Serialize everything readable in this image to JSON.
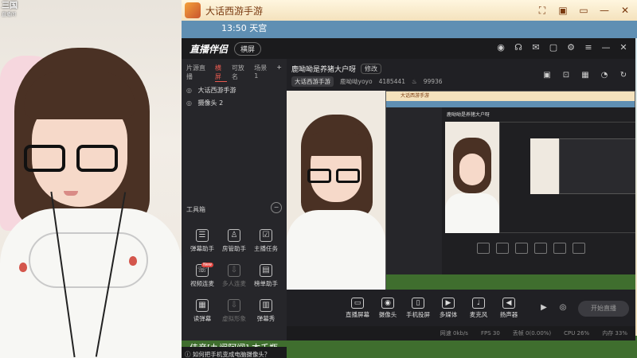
{
  "webcam_logo": {
    "title": "三国",
    "subtitle": "直播间"
  },
  "game": {
    "title": "大话西游手游",
    "clock": "13:50",
    "clock_sub": "天宫",
    "bottom_text": "佳音[九阙阿闻]   本千瓶"
  },
  "app": {
    "brand": "直播伴侣",
    "mode_label": "横屏",
    "tabs": [
      {
        "label": "片源直播"
      },
      {
        "label": "横屏"
      },
      {
        "label": "可放名"
      },
      {
        "label": "场景 1"
      }
    ],
    "sources": [
      {
        "label": "大话西游手游"
      },
      {
        "label": "摄像头 2"
      }
    ],
    "toolbox": {
      "title": "工具箱",
      "tools": [
        {
          "label": "弹幕助手",
          "icon": "barrage-icon"
        },
        {
          "label": "房管助手",
          "icon": "admin-icon"
        },
        {
          "label": "主播任务",
          "icon": "task-icon"
        },
        {
          "label": "视频连麦",
          "icon": "video-link-icon",
          "badge": "New"
        },
        {
          "label": "多人连麦",
          "icon": "multi-link-icon"
        },
        {
          "label": "榜单助手",
          "icon": "rank-icon"
        },
        {
          "label": "读弹幕",
          "icon": "read-barrage-icon"
        },
        {
          "label": "虚拟形象",
          "icon": "avatar-icon"
        },
        {
          "label": "弹幕秀",
          "icon": "barrage-show-icon"
        }
      ]
    },
    "tip": "如何把手机变成电脑摄像头？",
    "stream_title": "鹿呦呦是养猪大户呀",
    "edit_label": "修改",
    "category": "大话西游手游",
    "streamer": "鹿呦呦yoyo",
    "viewers": "4185441",
    "hot": "99936",
    "controls": [
      {
        "label": "直播屏幕",
        "icon": "screen-icon"
      },
      {
        "label": "摄像头",
        "icon": "camera-icon"
      },
      {
        "label": "手机投屏",
        "icon": "phone-cast-icon"
      },
      {
        "label": "多媒体",
        "icon": "media-icon"
      },
      {
        "label": "麦克风",
        "icon": "mic-icon"
      },
      {
        "label": "扬声器",
        "icon": "speaker-icon"
      }
    ],
    "live_button": "开始直播",
    "status": [
      {
        "label": "网速 0kb/s"
      },
      {
        "label": "FPS 30"
      },
      {
        "label": "丢帧 0(0.00%)"
      },
      {
        "label": "CPU 26%"
      },
      {
        "label": "内存 33%"
      }
    ],
    "nested_title": "鹿呦呦是养猪大户呀"
  }
}
